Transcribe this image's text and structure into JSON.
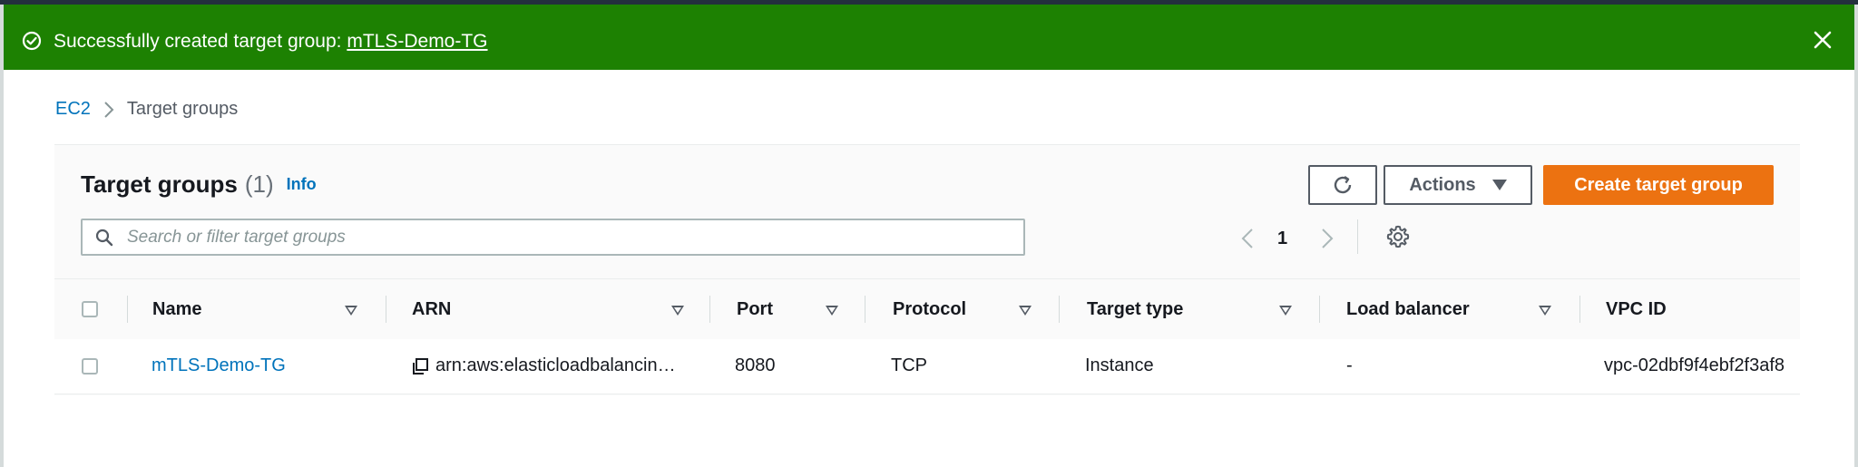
{
  "flash": {
    "message": "Successfully created target group: ",
    "link": "mTLS-Demo-TG",
    "icons": {
      "status": "check-circle-icon",
      "dismiss": "close-icon"
    }
  },
  "breadcrumb": {
    "items": [
      "EC2",
      "Target groups"
    ]
  },
  "panel": {
    "title": "Target groups",
    "count": "(1)",
    "info": "Info",
    "actions_label": "Actions",
    "create_label": "Create target group",
    "search_placeholder": "Search or filter target groups",
    "page": "1"
  },
  "table": {
    "columns": [
      "Name",
      "ARN",
      "Port",
      "Protocol",
      "Target type",
      "Load balancer",
      "VPC ID"
    ],
    "rows": [
      {
        "name": "mTLS-Demo-TG",
        "arn": "arn:aws:elasticloadbalancin…",
        "port": "8080",
        "protocol": "TCP",
        "target_type": "Instance",
        "load_balancer": "-",
        "vpc_id": "vpc-02dbf9f4ebf2f3af8"
      }
    ]
  },
  "colors": {
    "success": "#1d8102",
    "link": "#0073bb",
    "primary_button": "#ec7211"
  }
}
